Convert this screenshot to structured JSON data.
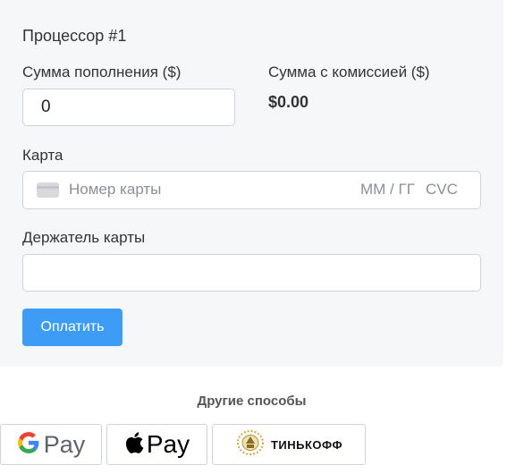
{
  "form": {
    "title": "Процессор #1",
    "amount_label": "Сумма пополнения ($)",
    "amount_value": "0",
    "fee_label": "Сумма с комиссией ($)",
    "fee_value": "$0.00",
    "card_label": "Карта",
    "card_number_placeholder": "Номер карты",
    "card_exp_placeholder": "ММ / ГГ",
    "card_cvc_placeholder": "CVC",
    "holder_label": "Держатель карты",
    "holder_value": "",
    "pay_button": "Оплатить"
  },
  "other": {
    "title": "Другие способы",
    "methods": [
      {
        "name": "google-pay",
        "word": "Pay"
      },
      {
        "name": "apple-pay",
        "word": "Pay"
      },
      {
        "name": "tinkoff",
        "word": "ТИНЬКОФФ"
      }
    ]
  },
  "colors": {
    "panel_bg": "#f6f7f9",
    "accent": "#3d9cf5",
    "border": "#cfd3d8"
  }
}
